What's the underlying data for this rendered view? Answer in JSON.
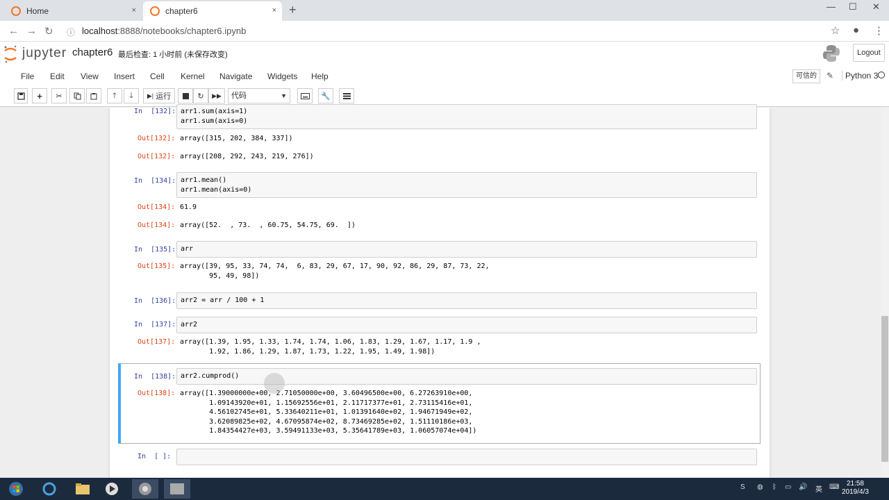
{
  "browser": {
    "tabs": [
      {
        "label": "Home",
        "close": "×"
      },
      {
        "label": "chapter6",
        "close": "×"
      }
    ],
    "new_tab": "+",
    "url_host": "localhost",
    "url_path": ":8888/notebooks/chapter6.ipynb",
    "window_controls": [
      "—",
      "☐",
      "✕"
    ]
  },
  "jupyter": {
    "logo_text": "jupyter",
    "notebook_name": "chapter6",
    "checkpoint": "最后检查: 1 小时前  (未保存改变)",
    "logout": "Logout",
    "menus": [
      "File",
      "Edit",
      "View",
      "Insert",
      "Cell",
      "Kernel",
      "Navigate",
      "Widgets",
      "Help"
    ],
    "trusted": "可信的",
    "kernel_name": "Python 3",
    "run_label": "运行",
    "cell_type": "代码"
  },
  "cells": [
    {
      "in": "In  [132]:",
      "code": "arr1.sum(axis=1)\narr1.sum(axis=0)",
      "outputs": [
        {
          "prompt": "Out[132]:",
          "text": "array([315, 202, 384, 337])"
        },
        {
          "prompt": "Out[132]:",
          "text": "array([208, 292, 243, 219, 276])"
        }
      ]
    },
    {
      "in": "In  [134]:",
      "code": "arr1.mean()\narr1.mean(axis=0)",
      "outputs": [
        {
          "prompt": "Out[134]:",
          "text": "61.9"
        },
        {
          "prompt": "Out[134]:",
          "text": "array([52.  , 73.  , 60.75, 54.75, 69.  ])"
        }
      ]
    },
    {
      "in": "In  [135]:",
      "code": "arr",
      "outputs": [
        {
          "prompt": "Out[135]:",
          "text": "array([39, 95, 33, 74, 74,  6, 83, 29, 67, 17, 90, 92, 86, 29, 87, 73, 22,\n       95, 49, 98])"
        }
      ]
    },
    {
      "in": "In  [136]:",
      "code": "arr2 = arr / 100 + 1",
      "outputs": []
    },
    {
      "in": "In  [137]:",
      "code": "arr2",
      "outputs": [
        {
          "prompt": "Out[137]:",
          "text": "array([1.39, 1.95, 1.33, 1.74, 1.74, 1.06, 1.83, 1.29, 1.67, 1.17, 1.9 ,\n       1.92, 1.86, 1.29, 1.87, 1.73, 1.22, 1.95, 1.49, 1.98])"
        }
      ]
    },
    {
      "in": "In  [138]:",
      "code": "arr2.cumprod()",
      "outputs": [
        {
          "prompt": "Out[138]:",
          "text": "array([1.39000000e+00, 2.71050000e+00, 3.60496500e+00, 6.27263910e+00,\n       1.09143920e+01, 1.15692556e+01, 2.11717377e+01, 2.73115416e+01,\n       4.56102745e+01, 5.33640211e+01, 1.01391640e+02, 1.94671949e+02,\n       3.62089825e+02, 4.67095874e+02, 8.73469285e+02, 1.51110186e+03,\n       1.84354427e+03, 3.59491133e+03, 5.35641789e+03, 1.06057074e+04])"
        }
      ]
    },
    {
      "in": "In  [ ]:",
      "code": "",
      "outputs": []
    }
  ],
  "taskbar": {
    "clock_time": "21:58",
    "clock_date": "2019/4/3"
  },
  "colors": {
    "in_prompt": "#303f9f",
    "out_prompt": "#d84315",
    "selected_cell": "#42a5f5"
  }
}
